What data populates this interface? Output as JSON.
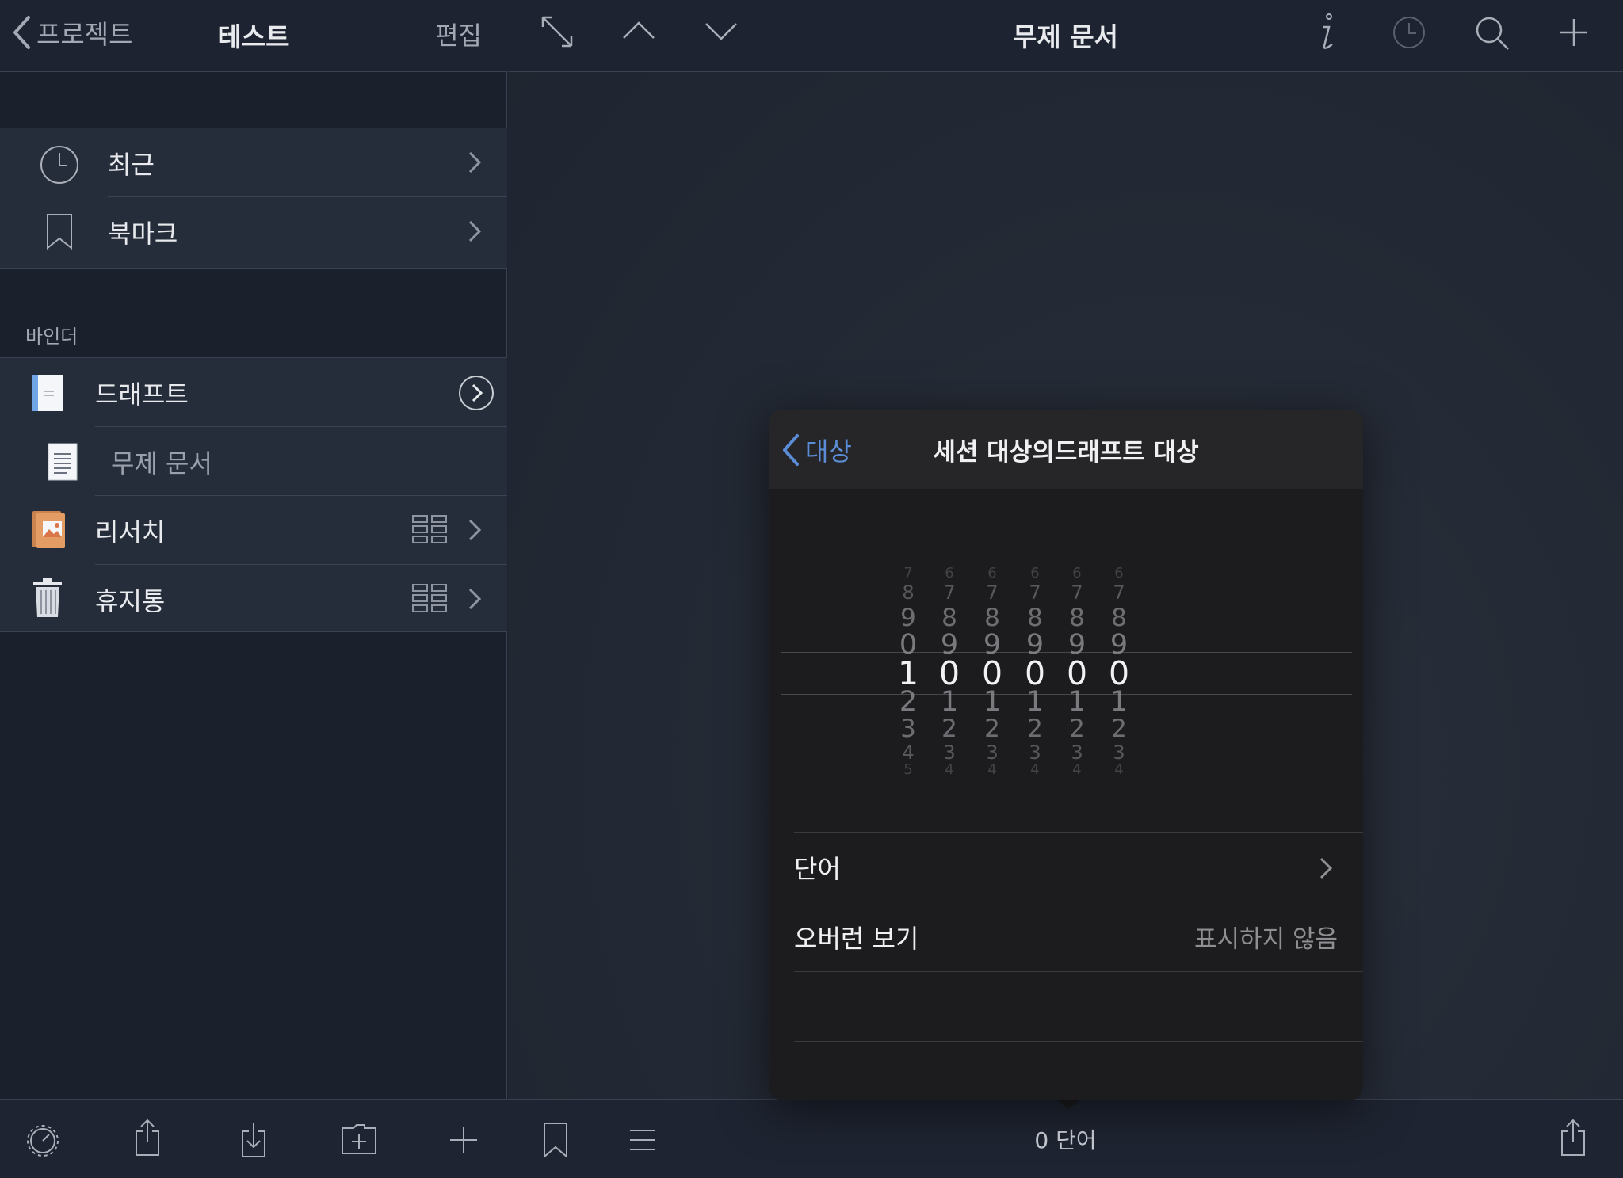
{
  "sidebar": {
    "back_label": "프로젝트",
    "title": "테스트",
    "edit_label": "편집",
    "quick_items": [
      {
        "label": "최근",
        "icon": "clock-icon"
      },
      {
        "label": "북마크",
        "icon": "bookmark-icon"
      }
    ],
    "binder_header": "바인더",
    "binder_items": [
      {
        "label": "드래프트",
        "icon": "draft-document-icon"
      },
      {
        "label": "무제 문서",
        "icon": "text-document-icon"
      },
      {
        "label": "리서치",
        "icon": "research-folder-icon"
      },
      {
        "label": "휴지통",
        "icon": "trash-icon"
      }
    ],
    "toolbar_icons": [
      "settings-gear-icon",
      "share-icon",
      "import-icon",
      "new-folder-icon",
      "add-icon"
    ]
  },
  "main": {
    "title": "무제 문서",
    "toolbar_icons": [
      "expand-icon",
      "previous-icon",
      "next-icon",
      "info-icon",
      "history-clock-icon",
      "search-icon",
      "add-icon"
    ],
    "word_count": "0 단어",
    "bottom_icons": [
      "bookmark-icon",
      "list-icon",
      "share-icon"
    ]
  },
  "popover": {
    "back_label": "대상",
    "title": "세션 대상의드래프트 대상",
    "picker": {
      "selected_digits": [
        "1",
        "0",
        "0",
        "0",
        "0",
        "0"
      ],
      "columns": [
        {
          "digits": [
            "7",
            "8",
            "9",
            "0",
            "1",
            "2",
            "3",
            "4",
            "5"
          ]
        },
        {
          "digits": [
            "6",
            "7",
            "8",
            "9",
            "0",
            "1",
            "2",
            "3",
            "4"
          ]
        },
        {
          "digits": [
            "6",
            "7",
            "8",
            "9",
            "0",
            "1",
            "2",
            "3",
            "4"
          ]
        },
        {
          "digits": [
            "6",
            "7",
            "8",
            "9",
            "0",
            "1",
            "2",
            "3",
            "4"
          ]
        },
        {
          "digits": [
            "6",
            "7",
            "8",
            "9",
            "0",
            "1",
            "2",
            "3",
            "4"
          ]
        },
        {
          "digits": [
            "6",
            "7",
            "8",
            "9",
            "0",
            "1",
            "2",
            "3",
            "4"
          ]
        }
      ]
    },
    "rows": [
      {
        "label": "단어",
        "value": ""
      },
      {
        "label": "오버런 보기",
        "value": "표시하지 않음"
      }
    ]
  },
  "colors": {
    "accent": "#5b8cd6",
    "sidebar_bg": "#1a202c",
    "row_bg": "#262d3a",
    "popover_bg": "#1c1c1e"
  }
}
